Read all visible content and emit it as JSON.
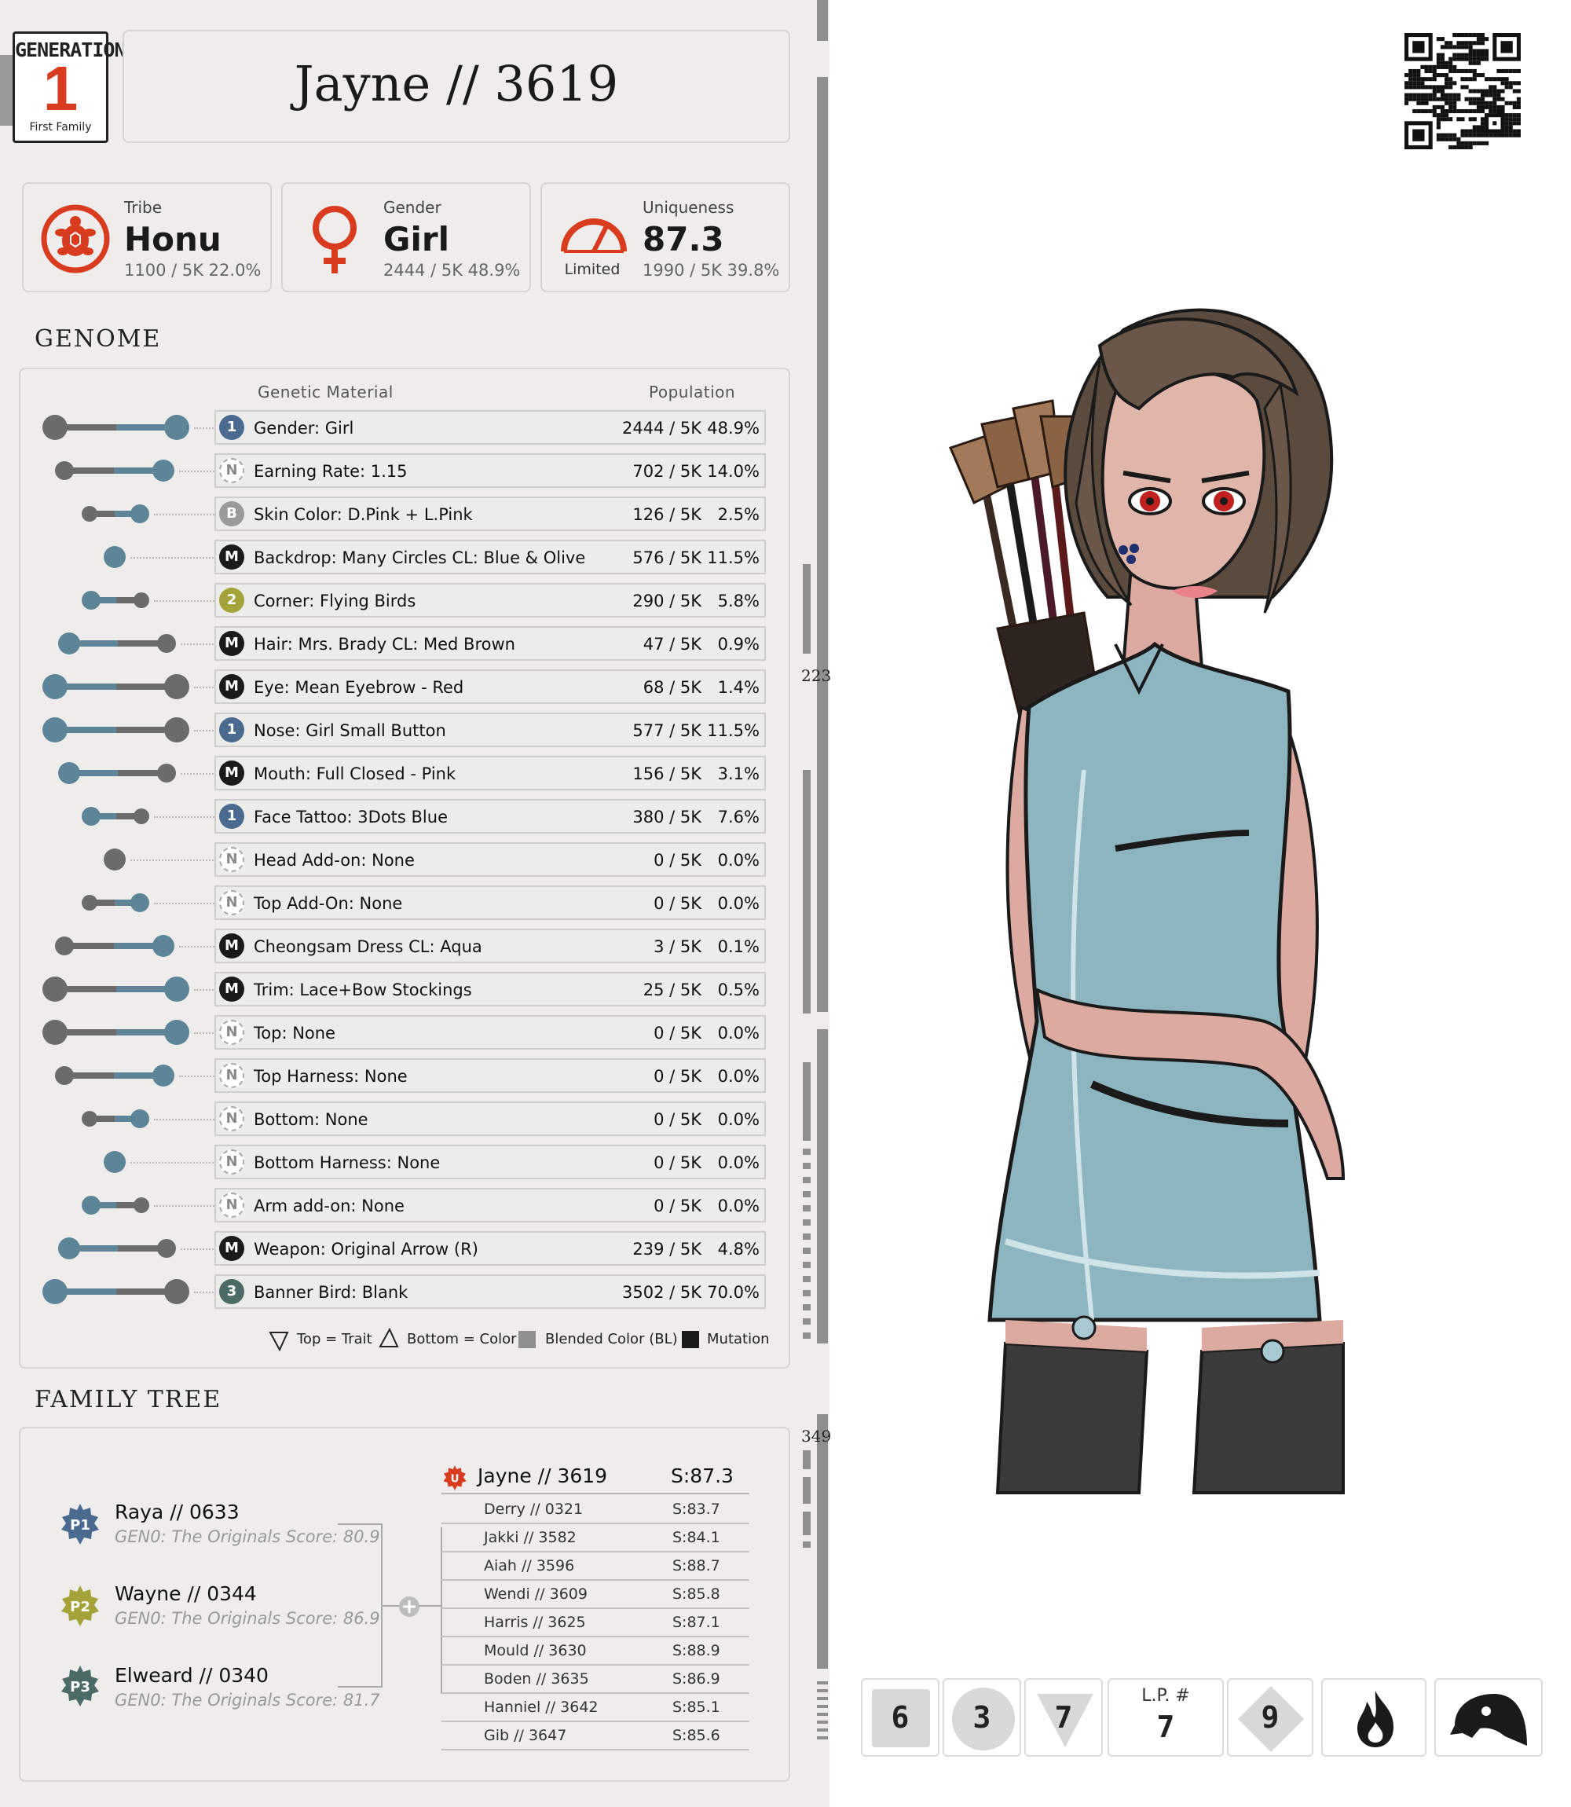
{
  "header": {
    "generation_word": "GENERATION",
    "generation_number": "1",
    "generation_sub": "First Family",
    "title": "Jayne // 3619"
  },
  "stats": {
    "tribe": {
      "label": "Tribe",
      "value": "Honu",
      "sub": "1100 / 5K  22.0%"
    },
    "gender": {
      "label": "Gender",
      "value": "Girl",
      "sub": "2444 / 5K  48.9%"
    },
    "uniqueness": {
      "label": "Uniqueness",
      "value": "87.3",
      "sub": "1990 / 5K  39.8%",
      "rating": "Limited"
    }
  },
  "genome": {
    "title": "GENOME",
    "col_material": "Genetic Material",
    "col_population": "Population",
    "rows": [
      {
        "badge": "1",
        "label": "Gender: Girl",
        "count": "2444 / 5K",
        "pct": "48.9%"
      },
      {
        "badge": "N",
        "label": "Earning Rate: 1.15",
        "count": "702 / 5K",
        "pct": "14.0%"
      },
      {
        "badge": "B",
        "label": "Skin Color: D.Pink + L.Pink",
        "count": "126 / 5K",
        "pct": "2.5%"
      },
      {
        "badge": "M",
        "label": "Backdrop: Many Circles CL: Blue & Olive",
        "count": "576 / 5K",
        "pct": "11.5%"
      },
      {
        "badge": "2",
        "label": "Corner: Flying Birds",
        "count": "290 / 5K",
        "pct": "5.8%"
      },
      {
        "badge": "M",
        "label": "Hair: Mrs. Brady CL: Med Brown",
        "count": "47 / 5K",
        "pct": "0.9%"
      },
      {
        "badge": "M",
        "label": "Eye: Mean Eyebrow - Red",
        "count": "68 / 5K",
        "pct": "1.4%"
      },
      {
        "badge": "1",
        "label": "Nose: Girl Small Button",
        "count": "577 / 5K",
        "pct": "11.5%"
      },
      {
        "badge": "M",
        "label": "Mouth: Full Closed - Pink",
        "count": "156 / 5K",
        "pct": "3.1%"
      },
      {
        "badge": "1",
        "label": "Face Tattoo: 3Dots Blue",
        "count": "380 / 5K",
        "pct": "7.6%"
      },
      {
        "badge": "N",
        "label": "Head Add-on:  None",
        "count": "0 / 5K",
        "pct": "0.0%"
      },
      {
        "badge": "N",
        "label": "Top Add-On: None",
        "count": "0 / 5K",
        "pct": "0.0%"
      },
      {
        "badge": "M",
        "label": "Cheongsam Dress CL: Aqua",
        "count": "3 / 5K",
        "pct": "0.1%"
      },
      {
        "badge": "M",
        "label": "Trim: Lace+Bow Stockings",
        "count": "25 / 5K",
        "pct": "0.5%"
      },
      {
        "badge": "N",
        "label": "Top: None",
        "count": "0 / 5K",
        "pct": "0.0%"
      },
      {
        "badge": "N",
        "label": "Top Harness: None",
        "count": "0 / 5K",
        "pct": "0.0%"
      },
      {
        "badge": "N",
        "label": "Bottom: None",
        "count": "0 / 5K",
        "pct": "0.0%"
      },
      {
        "badge": "N",
        "label": "Bottom Harness: None",
        "count": "0 / 5K",
        "pct": "0.0%"
      },
      {
        "badge": "N",
        "label": "Arm add-on: None",
        "count": "0 / 5K",
        "pct": "0.0%"
      },
      {
        "badge": "M",
        "label": "Weapon: Original Arrow (R)",
        "count": "239 / 5K",
        "pct": "4.8%"
      },
      {
        "badge": "3",
        "label": "Banner Bird:  Blank",
        "count": "3502 / 5K",
        "pct": "70.0%"
      }
    ],
    "legend": {
      "top": "Top = Trait",
      "bottom": "Bottom = Color",
      "blended": "Blended Color (BL)",
      "mutation": "Mutation"
    }
  },
  "family": {
    "title": "FAMILY TREE",
    "parents": [
      {
        "tag": "P1",
        "name": "Raya  //  0633",
        "sub": "GEN0: The Originals Score: 80.9"
      },
      {
        "tag": "P2",
        "name": "Wayne  //  0344",
        "sub": "GEN0: The Originals Score: 86.9"
      },
      {
        "tag": "P3",
        "name": "Elweard  //  0340",
        "sub": "GEN0: The Originals Score: 81.7"
      }
    ],
    "self": {
      "badge": "U",
      "name": "Jayne // 3619",
      "score": "S:87.3"
    },
    "siblings": [
      {
        "name": "Derry  //  0321",
        "score": "S:83.7"
      },
      {
        "name": "Jakki  //  3582",
        "score": "S:84.1"
      },
      {
        "name": "Aiah  //  3596",
        "score": "S:88.7"
      },
      {
        "name": "Wendi  //  3609",
        "score": "S:85.8"
      },
      {
        "name": "Harris  //  3625",
        "score": "S:87.1"
      },
      {
        "name": "Mould  //  3630",
        "score": "S:88.9"
      },
      {
        "name": "Boden  //  3635",
        "score": "S:86.9"
      },
      {
        "name": "Hanniel  //  3642",
        "score": "S:85.1"
      },
      {
        "name": "Gib  //  3647",
        "score": "S:85.6"
      }
    ]
  },
  "side_axis": {
    "mark_1": "223",
    "mark_2": "349"
  },
  "tiles": {
    "t1": "6",
    "t2": "3",
    "t3": "7",
    "lp_label": "L.P. #",
    "lp_value": "7",
    "t5": "9"
  },
  "colors": {
    "accent_red": "#d93b1f",
    "steel_blue": "#5d8597",
    "gray": "#6b6b6b",
    "dress_aqua": "#8db5bf"
  }
}
